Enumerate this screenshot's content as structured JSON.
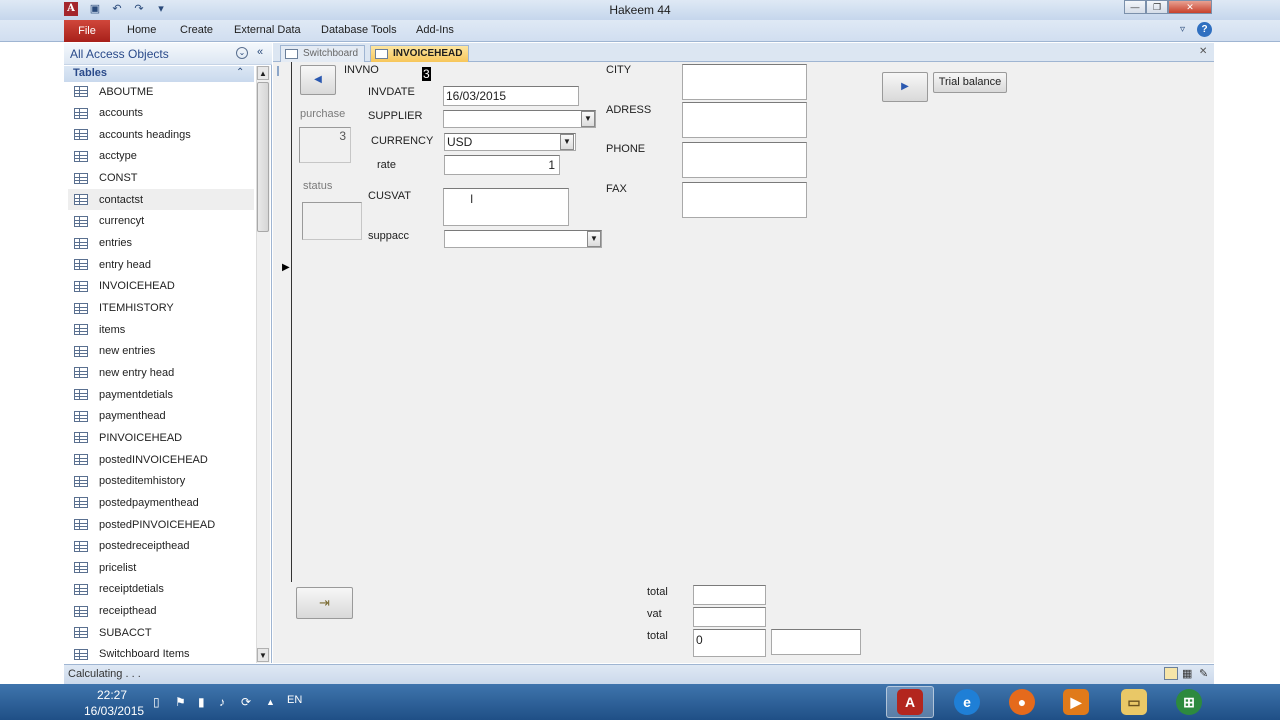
{
  "window": {
    "title": "Hakeem 44"
  },
  "ribbon": {
    "file": "File",
    "tabs": [
      "Home",
      "Create",
      "External Data",
      "Database Tools",
      "Add-Ins"
    ]
  },
  "nav": {
    "title": "All Access Objects",
    "section": "Tables",
    "items": [
      "ABOUTME",
      "accounts",
      "accounts headings",
      "acctype",
      "CONST",
      "contactst",
      "currencyt",
      "entries",
      "entry head",
      "INVOICEHEAD",
      "ITEMHISTORY",
      "items",
      "new entries",
      "new entry head",
      "paymentdetials",
      "paymenthead",
      "PINVOICEHEAD",
      "postedINVOICEHEAD",
      "posteditemhistory",
      "postedpaymenthead",
      "postedPINVOICEHEAD",
      "postedreceipthead",
      "pricelist",
      "receiptdetials",
      "receipthead",
      "SUBACCT",
      "Switchboard Items"
    ],
    "highlighted": "contactst"
  },
  "doc_tabs": [
    {
      "label": "Switchboard",
      "active": false
    },
    {
      "label": "INVOICEHEAD",
      "active": true
    }
  ],
  "form": {
    "invno_label": "INVNO",
    "invno_value": "3",
    "purchase_label": "purchase",
    "purchase_value": "3",
    "status_label": "status",
    "invdate_label": "INVDATE",
    "invdate_value": "16/03/2015",
    "supplier_label": "SUPPLIER",
    "supplier_value": "",
    "currency_label": "CURRENCY",
    "currency_value": "USD",
    "rate_label": "rate",
    "rate_value": "1",
    "cusvat_label": "CUSVAT",
    "suppacc_label": "suppacc",
    "city_label": "CITY",
    "adress_label": "ADRESS",
    "phone_label": "PHONE",
    "fax_label": "FAX",
    "trial_balance_label": "Trial balance",
    "total_label": "total",
    "vat_label": "vat",
    "total2_label": "total",
    "total2_value": "0"
  },
  "statusbar": {
    "text": "Calculating . . ."
  },
  "taskbar": {
    "time": "22:27",
    "date": "16/03/2015",
    "lang": "EN"
  },
  "colors": {
    "file_tab": "#b3261e",
    "ribbon": "#d1def0",
    "form_bg": "#f0f0f0",
    "taskbar": "#2f5f96"
  }
}
